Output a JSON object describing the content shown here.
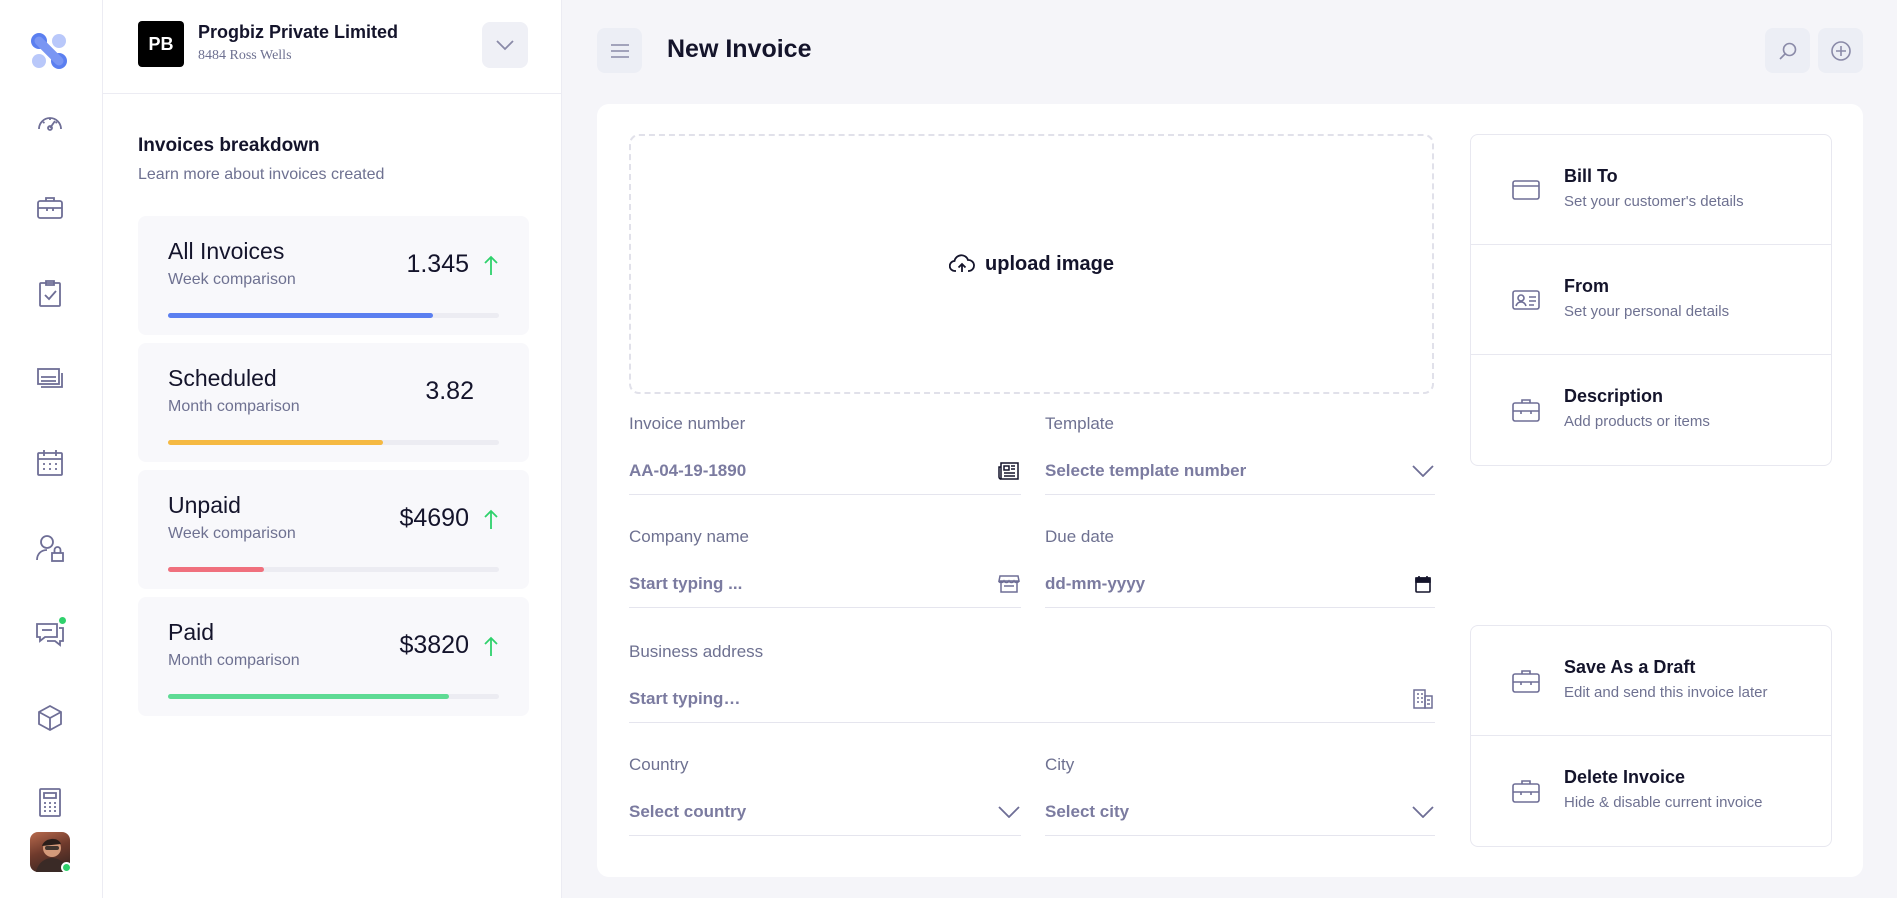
{
  "company": {
    "initials": "PB",
    "name": "Progbiz Private Limited",
    "address": "8484 Ross Wells"
  },
  "breakdown": {
    "title": "Invoices breakdown",
    "subtitle": "Learn more about invoices created",
    "stats": [
      {
        "label": "All Invoices",
        "sub": "Week comparison",
        "value": "1.345",
        "trend": "up",
        "progress": 0.8,
        "color": "#5b7ff0"
      },
      {
        "label": "Scheduled",
        "sub": "Month comparison",
        "value": "3.82",
        "trend": "none",
        "progress": 0.65,
        "color": "#f5b942"
      },
      {
        "label": "Unpaid",
        "sub": "Week comparison",
        "value": "$4690",
        "trend": "up",
        "progress": 0.29,
        "color": "#f0707d"
      },
      {
        "label": "Paid",
        "sub": "Month comparison",
        "value": "$3820",
        "trend": "up",
        "progress": 0.85,
        "color": "#5edb94"
      }
    ]
  },
  "header": {
    "title": "New Invoice"
  },
  "upload": {
    "label": "upload image"
  },
  "form": {
    "invoice_number": {
      "label": "Invoice number",
      "value": "AA-04-19-1890"
    },
    "template": {
      "label": "Template",
      "placeholder": "Selecte template number"
    },
    "company_name": {
      "label": "Company name",
      "placeholder": "Start typing ..."
    },
    "due_date": {
      "label": "Due date",
      "placeholder": "dd-mm-yyyy"
    },
    "business_address": {
      "label": "Business address",
      "placeholder": "Start typing…"
    },
    "country": {
      "label": "Country",
      "placeholder": "Select country"
    },
    "city": {
      "label": "City",
      "placeholder": "Select city"
    }
  },
  "sections": [
    {
      "title": "Bill To",
      "sub": "Set your customer's details",
      "icon": "credit-card-icon"
    },
    {
      "title": "From",
      "sub": "Set your personal details",
      "icon": "id-card-icon"
    },
    {
      "title": "Description",
      "sub": "Add products or items",
      "icon": "briefcase-icon"
    }
  ],
  "invoice_actions": [
    {
      "title": "Save As a Draft",
      "sub": "Edit and send this invoice later",
      "icon": "briefcase-icon"
    },
    {
      "title": "Delete Invoice",
      "sub": "Hide & disable current invoice",
      "icon": "briefcase-icon"
    }
  ],
  "sidebar_icons": [
    "dashboard-icon",
    "briefcase-icon",
    "clipboard-check-icon",
    "gallery-icon",
    "calendar-icon",
    "user-lock-icon",
    "chat-icon",
    "box-icon",
    "calculator-icon"
  ]
}
